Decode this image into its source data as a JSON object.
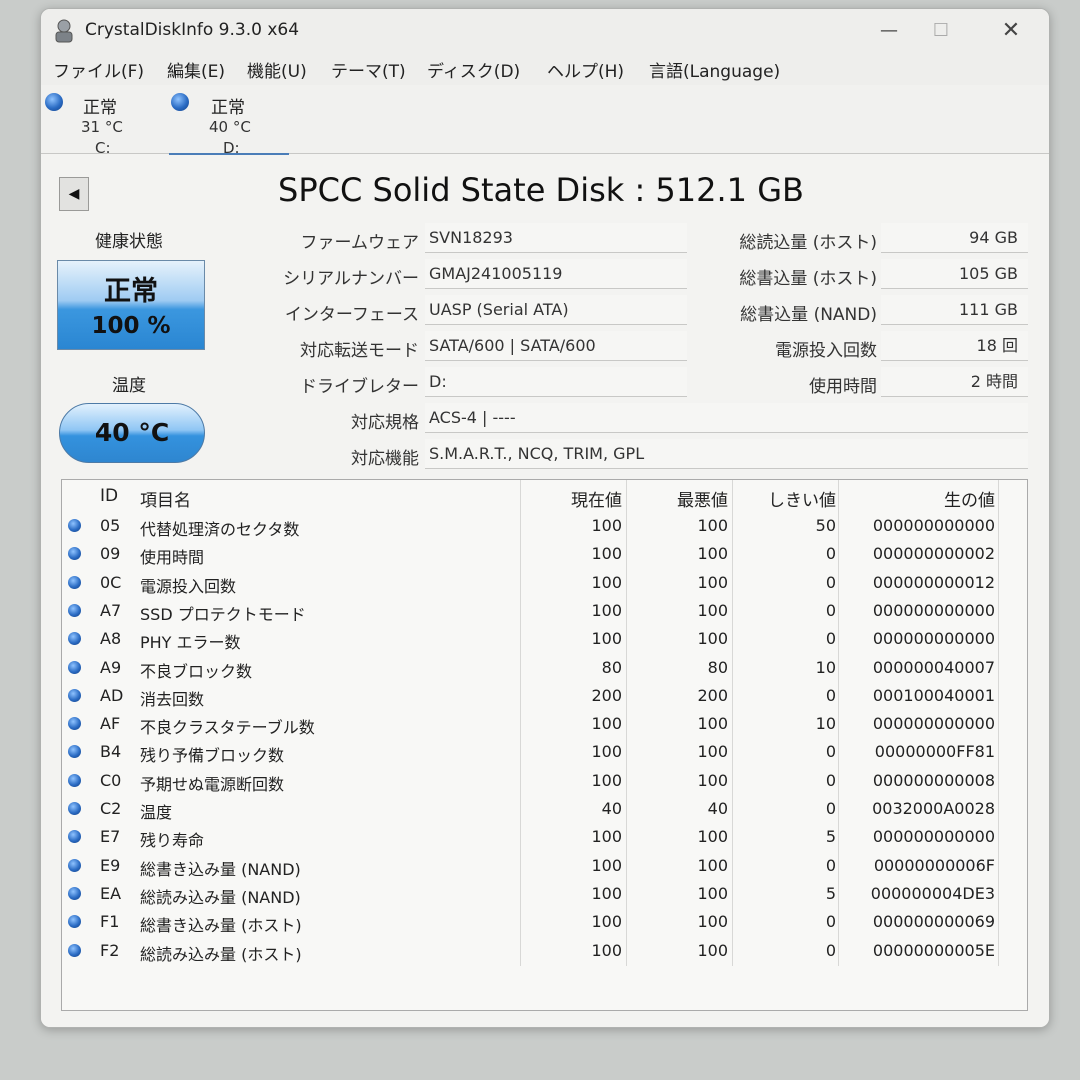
{
  "titlebar": {
    "title": "CrystalDiskInfo 9.3.0 x64",
    "minimize": "—",
    "maximize": "☐",
    "close": "✕"
  },
  "menu": [
    "ファイル(F)",
    "編集(E)",
    "機能(U)",
    "テーマ(T)",
    "ディスク(D)",
    "ヘルプ(H)",
    "言語(Language)"
  ],
  "disks": [
    {
      "status": "正常",
      "temp": "31 °C",
      "letter": "C:"
    },
    {
      "status": "正常",
      "temp": "40 °C",
      "letter": "D:"
    }
  ],
  "model": "SPCC Solid State Disk : 512.1 GB",
  "back": "◀",
  "health": {
    "label": "健康状態",
    "status": "正常",
    "percent": "100 %"
  },
  "temperature": {
    "label": "温度",
    "value": "40 °C"
  },
  "info": [
    {
      "label": "ファームウェア",
      "value": "SVN18293"
    },
    {
      "label": "シリアルナンバー",
      "value": "GMAJ241005119"
    },
    {
      "label": "インターフェース",
      "value": "UASP (Serial ATA)"
    },
    {
      "label": "対応転送モード",
      "value": "SATA/600 | SATA/600"
    },
    {
      "label": "ドライブレター",
      "value": "D:"
    },
    {
      "label": "対応規格",
      "value": "ACS-4 | ----"
    },
    {
      "label": "対応機能",
      "value": "S.M.A.R.T., NCQ, TRIM, GPL"
    }
  ],
  "stats": [
    {
      "label": "総読込量 (ホスト)",
      "value": "94 GB"
    },
    {
      "label": "総書込量 (ホスト)",
      "value": "105 GB"
    },
    {
      "label": "総書込量 (NAND)",
      "value": "111 GB"
    },
    {
      "label": "電源投入回数",
      "value": "18 回"
    },
    {
      "label": "使用時間",
      "value": "2 時間"
    }
  ],
  "smart": {
    "headers": {
      "id": "ID",
      "name": "項目名",
      "current": "現在値",
      "worst": "最悪値",
      "threshold": "しきい値",
      "raw": "生の値"
    },
    "rows": [
      {
        "id": "05",
        "name": "代替処理済のセクタ数",
        "current": "100",
        "worst": "100",
        "threshold": "50",
        "raw": "000000000000"
      },
      {
        "id": "09",
        "name": "使用時間",
        "current": "100",
        "worst": "100",
        "threshold": "0",
        "raw": "000000000002"
      },
      {
        "id": "0C",
        "name": "電源投入回数",
        "current": "100",
        "worst": "100",
        "threshold": "0",
        "raw": "000000000012"
      },
      {
        "id": "A7",
        "name": "SSD プロテクトモード",
        "current": "100",
        "worst": "100",
        "threshold": "0",
        "raw": "000000000000"
      },
      {
        "id": "A8",
        "name": "PHY エラー数",
        "current": "100",
        "worst": "100",
        "threshold": "0",
        "raw": "000000000000"
      },
      {
        "id": "A9",
        "name": "不良ブロック数",
        "current": "80",
        "worst": "80",
        "threshold": "10",
        "raw": "000000040007"
      },
      {
        "id": "AD",
        "name": "消去回数",
        "current": "200",
        "worst": "200",
        "threshold": "0",
        "raw": "000100040001"
      },
      {
        "id": "AF",
        "name": "不良クラスタテーブル数",
        "current": "100",
        "worst": "100",
        "threshold": "10",
        "raw": "000000000000"
      },
      {
        "id": "B4",
        "name": "残り予備ブロック数",
        "current": "100",
        "worst": "100",
        "threshold": "0",
        "raw": "00000000FF81"
      },
      {
        "id": "C0",
        "name": "予期せぬ電源断回数",
        "current": "100",
        "worst": "100",
        "threshold": "0",
        "raw": "000000000008"
      },
      {
        "id": "C2",
        "name": "温度",
        "current": "40",
        "worst": "40",
        "threshold": "0",
        "raw": "0032000A0028"
      },
      {
        "id": "E7",
        "name": "残り寿命",
        "current": "100",
        "worst": "100",
        "threshold": "5",
        "raw": "000000000000"
      },
      {
        "id": "E9",
        "name": "総書き込み量 (NAND)",
        "current": "100",
        "worst": "100",
        "threshold": "0",
        "raw": "00000000006F"
      },
      {
        "id": "EA",
        "name": "総読み込み量 (NAND)",
        "current": "100",
        "worst": "100",
        "threshold": "5",
        "raw": "000000004DE3"
      },
      {
        "id": "F1",
        "name": "総書き込み量 (ホスト)",
        "current": "100",
        "worst": "100",
        "threshold": "0",
        "raw": "000000000069"
      },
      {
        "id": "F2",
        "name": "総読み込み量 (ホスト)",
        "current": "100",
        "worst": "100",
        "threshold": "0",
        "raw": "00000000005E"
      }
    ]
  },
  "colors": {
    "status_good": "#2b6cc4",
    "health_box": "#3b97df"
  },
  "icons": [
    "app-icon",
    "status-dot-icon",
    "back-arrow-icon"
  ]
}
